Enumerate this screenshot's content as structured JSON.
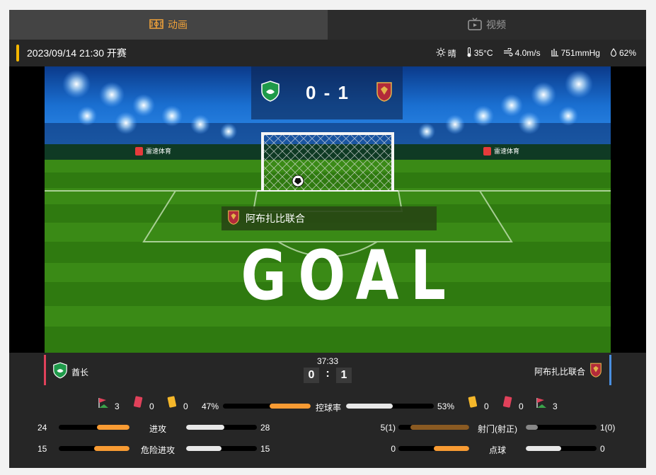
{
  "tabs": [
    {
      "label": "动画",
      "active": true,
      "icon": "pitch-icon"
    },
    {
      "label": "视频",
      "active": false,
      "icon": "tv-icon"
    }
  ],
  "match_info": {
    "kickoff": "2023/09/14 21:30 开赛",
    "weather": "晴",
    "temperature": "35°C",
    "wind": "4.0m/s",
    "pressure": "751mmHg",
    "humidity": "62%"
  },
  "animation": {
    "score": "0 - 1",
    "goal_team": "阿布扎比联合",
    "goal_text": "GOAL",
    "sponsor": "雷速体育"
  },
  "scoreboard": {
    "home_name": "酋长",
    "away_name": "阿布扎比联合",
    "time": "37:33",
    "home_score": "0",
    "away_score": "1"
  },
  "stats": {
    "home_corners": "3",
    "home_red": "0",
    "home_yellow": "0",
    "away_yellow": "0",
    "away_red": "0",
    "away_corners": "3",
    "possession_label": "控球率",
    "possession_home": "47%",
    "possession_away": "53%",
    "possession_home_value": 0.47,
    "possession_away_value": 0.53,
    "rows_left": [
      {
        "label": "进攻",
        "home": "24",
        "away": "28",
        "home_fill": 0.46,
        "away_fill": 0.54
      },
      {
        "label": "危险进攻",
        "home": "15",
        "away": "15",
        "home_fill": 0.5,
        "away_fill": 0.5
      }
    ],
    "rows_right": [
      {
        "label": "射门(射正)",
        "home": "5(1)",
        "away": "1(0)",
        "home_fill": 0.83,
        "away_fill": 0.17
      },
      {
        "label": "点球",
        "home": "0",
        "away": "0",
        "home_fill": 0.5,
        "away_fill": 0.5
      }
    ]
  },
  "colors": {
    "accent": "#f89b33",
    "home_side": "#e0415a",
    "away_side": "#4a8fe0",
    "yellow_bar": "#f5b700"
  }
}
